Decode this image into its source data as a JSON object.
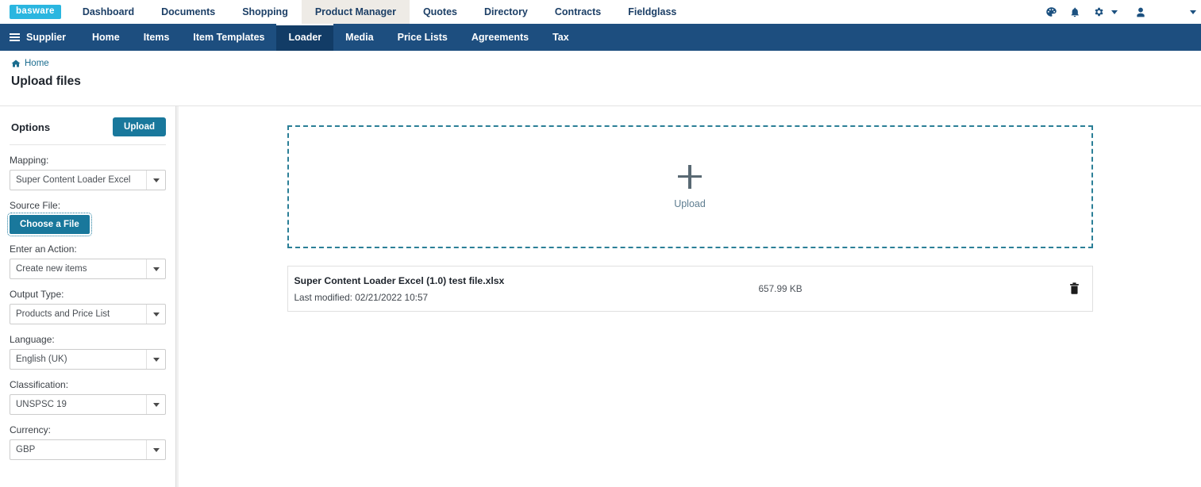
{
  "brand": {
    "logo_text": "basware",
    "logo_bg": "#2ab6e0",
    "accent_teal": "#19789c",
    "navy": "#1d4e7f",
    "navy_active": "#123c66",
    "dashed_border": "#2b7f97"
  },
  "topnav": {
    "items": [
      {
        "label": "Dashboard",
        "active": false
      },
      {
        "label": "Documents",
        "active": false
      },
      {
        "label": "Shopping",
        "active": false
      },
      {
        "label": "Product Manager",
        "active": true
      },
      {
        "label": "Quotes",
        "active": false
      },
      {
        "label": "Directory",
        "active": false
      },
      {
        "label": "Contracts",
        "active": false
      },
      {
        "label": "Fieldglass",
        "active": false
      }
    ],
    "icons": [
      {
        "name": "palette-icon"
      },
      {
        "name": "bell-icon"
      },
      {
        "name": "gear-icon"
      },
      {
        "name": "user-icon"
      }
    ]
  },
  "subnav": {
    "menu_label": "Supplier",
    "items": [
      {
        "label": "Home",
        "active": false
      },
      {
        "label": "Items",
        "active": false
      },
      {
        "label": "Item Templates",
        "active": false
      },
      {
        "label": "Loader",
        "active": true
      },
      {
        "label": "Media",
        "active": false
      },
      {
        "label": "Price Lists",
        "active": false
      },
      {
        "label": "Agreements",
        "active": false
      },
      {
        "label": "Tax",
        "active": false
      }
    ]
  },
  "breadcrumb": {
    "home_label": "Home"
  },
  "page": {
    "title": "Upload files"
  },
  "sidebar": {
    "title": "Options",
    "upload_button": "Upload",
    "fields": [
      {
        "label": "Mapping:",
        "value": "Super Content Loader Excel",
        "type": "select"
      },
      {
        "label": "Source File:",
        "value": "Choose a File",
        "type": "button"
      },
      {
        "label": "Enter an Action:",
        "value": "Create new items",
        "type": "select"
      },
      {
        "label": "Output Type:",
        "value": "Products and Price List",
        "type": "select"
      },
      {
        "label": "Language:",
        "value": "English (UK)",
        "type": "select"
      },
      {
        "label": "Classification:",
        "value": "UNSPSC 19",
        "type": "select"
      },
      {
        "label": "Currency:",
        "value": "GBP",
        "type": "select"
      }
    ]
  },
  "dropzone": {
    "label": "Upload"
  },
  "files": [
    {
      "name": "Super Content Loader Excel (1.0) test file.xlsx",
      "modified": "Last modified: 02/21/2022 10:57",
      "size": "657.99 KB"
    }
  ]
}
